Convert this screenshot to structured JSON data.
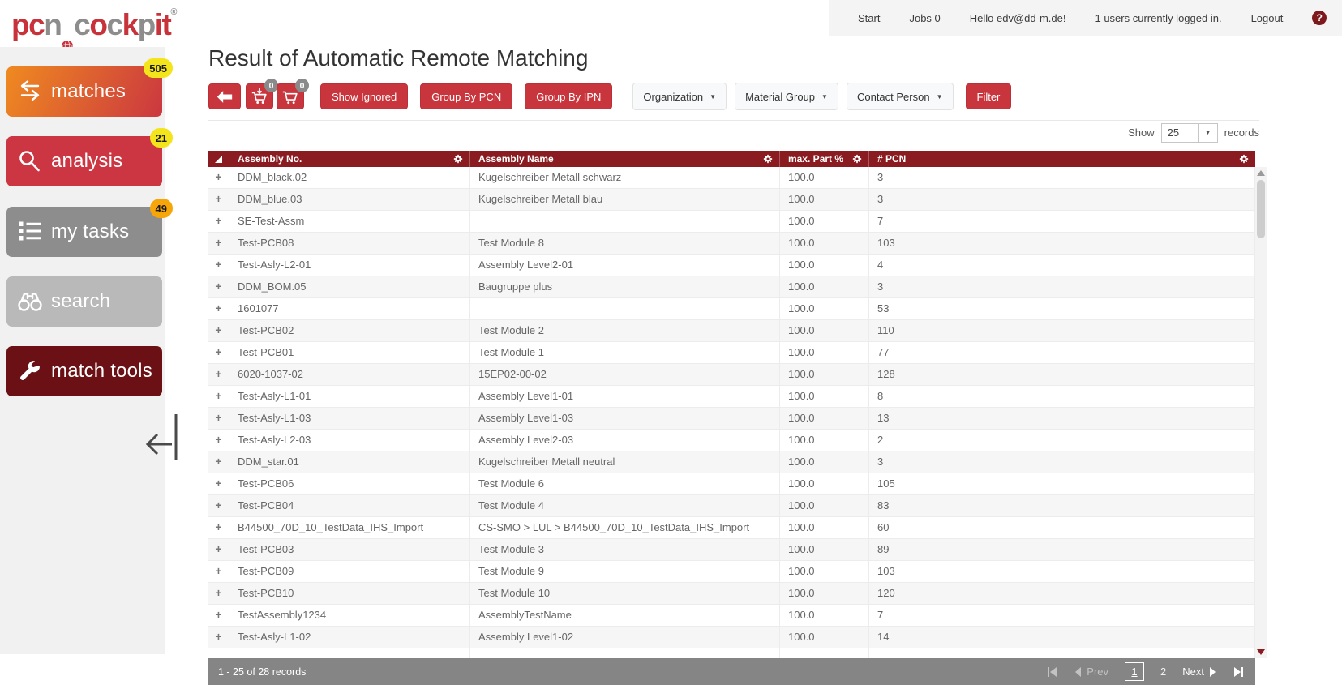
{
  "logo": {
    "letters": [
      {
        "ch": "p",
        "color": "#c8333b"
      },
      {
        "ch": "c",
        "color": "#c8333b"
      },
      {
        "ch": "n",
        "color": "#8d8d8d"
      },
      {
        "ch": "globe",
        "color": "#c8333b"
      },
      {
        "ch": "c",
        "color": "#8d8d8d"
      },
      {
        "ch": "o",
        "color": "#c8333b"
      },
      {
        "ch": "c",
        "color": "#8d8d8d"
      },
      {
        "ch": "k",
        "color": "#c8333b"
      },
      {
        "ch": "p",
        "color": "#8d8d8d"
      },
      {
        "ch": "i",
        "color": "#c8333b"
      },
      {
        "ch": "t",
        "color": "#c8333b"
      }
    ],
    "registered": "®"
  },
  "topbar": {
    "items": [
      "Start",
      "Jobs 0",
      "Hello edv@dd-m.de!",
      "1 users currently logged in.",
      "Logout"
    ],
    "help_icon": "?"
  },
  "sidebar": {
    "items": [
      {
        "label": "matches",
        "icon": "transfer-arrows-icon",
        "badge": "505",
        "badge_color": "#f3e41c",
        "bg_from": "#ef8a20",
        "bg_to": "#cb3740"
      },
      {
        "label": "analysis",
        "icon": "magnifier-icon",
        "badge": "21",
        "badge_color": "#f3e41c",
        "bg": "#cb3642"
      },
      {
        "label": "my tasks",
        "icon": "task-list-icon",
        "badge": "49",
        "badge_color": "#f7a60a",
        "bg": "#8d8d8d"
      },
      {
        "label": "search",
        "icon": "binoculars-icon",
        "bg": "#b9b9b9"
      },
      {
        "label": "match tools",
        "icon": "wrench-icon",
        "bg": "#6b1116"
      }
    ]
  },
  "page": {
    "title": "Result of Automatic Remote Matching"
  },
  "toolbar": {
    "buttons": [
      "Show Ignored",
      "Group By PCN",
      "Group By IPN"
    ],
    "cart_badges": [
      "0",
      "0"
    ],
    "dropdowns": [
      "Organization",
      "Material Group",
      "Contact Person"
    ],
    "filter_label": "Filter",
    "accent_color": "#c9353d"
  },
  "records_bar": {
    "show_label": "Show",
    "page_size": "25",
    "records_label": "records"
  },
  "table": {
    "header_color": "#8a1b20",
    "columns": [
      "Assembly No.",
      "Assembly Name",
      "max. Part %",
      "# PCN"
    ],
    "rows": [
      [
        "DDM_black.02",
        "Kugelschreiber Metall schwarz",
        "100.0",
        "3"
      ],
      [
        "DDM_blue.03",
        "Kugelschreiber Metall blau",
        "100.0",
        "3"
      ],
      [
        "SE-Test-Assm",
        "",
        "100.0",
        "7"
      ],
      [
        "Test-PCB08",
        "Test Module 8",
        "100.0",
        "103"
      ],
      [
        "Test-Asly-L2-01",
        "Assembly Level2-01",
        "100.0",
        "4"
      ],
      [
        "DDM_BOM.05",
        "Baugruppe plus",
        "100.0",
        "3"
      ],
      [
        "1601077",
        "",
        "100.0",
        "53"
      ],
      [
        "Test-PCB02",
        "Test Module 2",
        "100.0",
        "110"
      ],
      [
        "Test-PCB01",
        "Test Module 1",
        "100.0",
        "77"
      ],
      [
        "6020-1037-02",
        "15EP02-00-02",
        "100.0",
        "128"
      ],
      [
        "Test-Asly-L1-01",
        "Assembly Level1-01",
        "100.0",
        "8"
      ],
      [
        "Test-Asly-L1-03",
        "Assembly Level1-03",
        "100.0",
        "13"
      ],
      [
        "Test-Asly-L2-03",
        "Assembly Level2-03",
        "100.0",
        "2"
      ],
      [
        "DDM_star.01",
        "Kugelschreiber Metall neutral",
        "100.0",
        "3"
      ],
      [
        "Test-PCB06",
        "Test Module 6",
        "100.0",
        "105"
      ],
      [
        "Test-PCB04",
        "Test Module 4",
        "100.0",
        "83"
      ],
      [
        "B44500_70D_10_TestData_IHS_Import",
        "CS-SMO > LUL > B44500_70D_10_TestData_IHS_Import",
        "100.0",
        "60"
      ],
      [
        "Test-PCB03",
        "Test Module 3",
        "100.0",
        "89"
      ],
      [
        "Test-PCB09",
        "Test Module 9",
        "100.0",
        "103"
      ],
      [
        "Test-PCB10",
        "Test Module 10",
        "100.0",
        "120"
      ],
      [
        "TestAssembly1234",
        "AssemblyTestName",
        "100.0",
        "7"
      ],
      [
        "Test-Asly-L1-02",
        "Assembly Level1-02",
        "100.0",
        "14"
      ]
    ]
  },
  "footer": {
    "summary": "1 - 25 of 28 records",
    "prev_label": "Prev",
    "next_label": "Next",
    "pages": [
      "1",
      "2"
    ],
    "current_page": "1",
    "bar_color": "#858585"
  }
}
